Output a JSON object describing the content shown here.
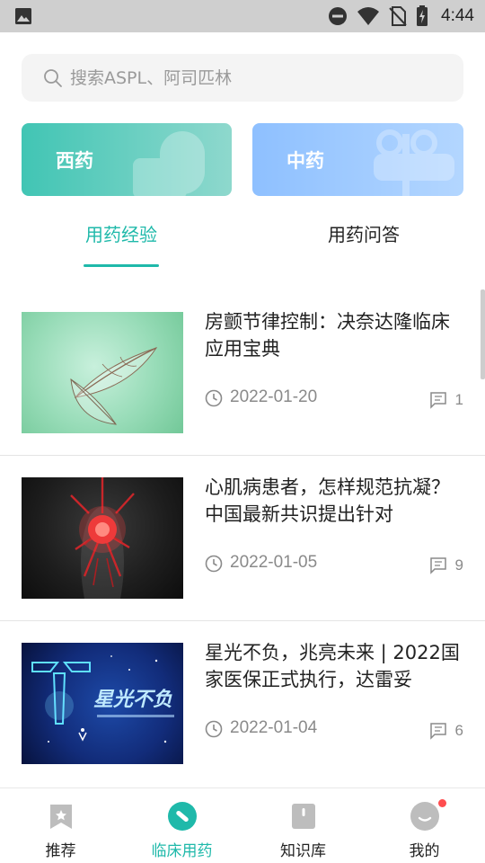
{
  "status_bar": {
    "time": "4:44",
    "icons": [
      "image-notification-icon",
      "do-not-disturb-icon",
      "wifi-icon",
      "no-sim-icon",
      "battery-charging-icon"
    ]
  },
  "search": {
    "placeholder": "搜索ASPL、阿司匹林"
  },
  "categories": [
    {
      "label": "西药",
      "color": "#41c5b4"
    },
    {
      "label": "中药",
      "color": "#8ec0ff"
    }
  ],
  "tabs": [
    {
      "label": "用药经验",
      "active": true
    },
    {
      "label": "用药问答",
      "active": false
    }
  ],
  "accent_color": "#1fb9aa",
  "articles": [
    {
      "title": "房颤节律控制：决奈达隆临床应用宝典",
      "date": "2022-01-20",
      "comments": "1"
    },
    {
      "title": "心肌病患者，怎样规范抗凝？中国最新共识提出针对",
      "date": "2022-01-05",
      "comments": "9"
    },
    {
      "title": "星光不负，兆亮未来 | 2022国家医保正式执行，达雷妥",
      "date": "2022-01-04",
      "comments": "6",
      "thumb_text": "星光不负"
    }
  ],
  "bottom_nav": [
    {
      "label": "推荐",
      "icon": "bookmark-icon",
      "active": false
    },
    {
      "label": "临床用药",
      "icon": "pill-icon",
      "active": true
    },
    {
      "label": "知识库",
      "icon": "book-icon",
      "active": false
    },
    {
      "label": "我的",
      "icon": "profile-icon",
      "active": false,
      "has_badge": true
    }
  ]
}
